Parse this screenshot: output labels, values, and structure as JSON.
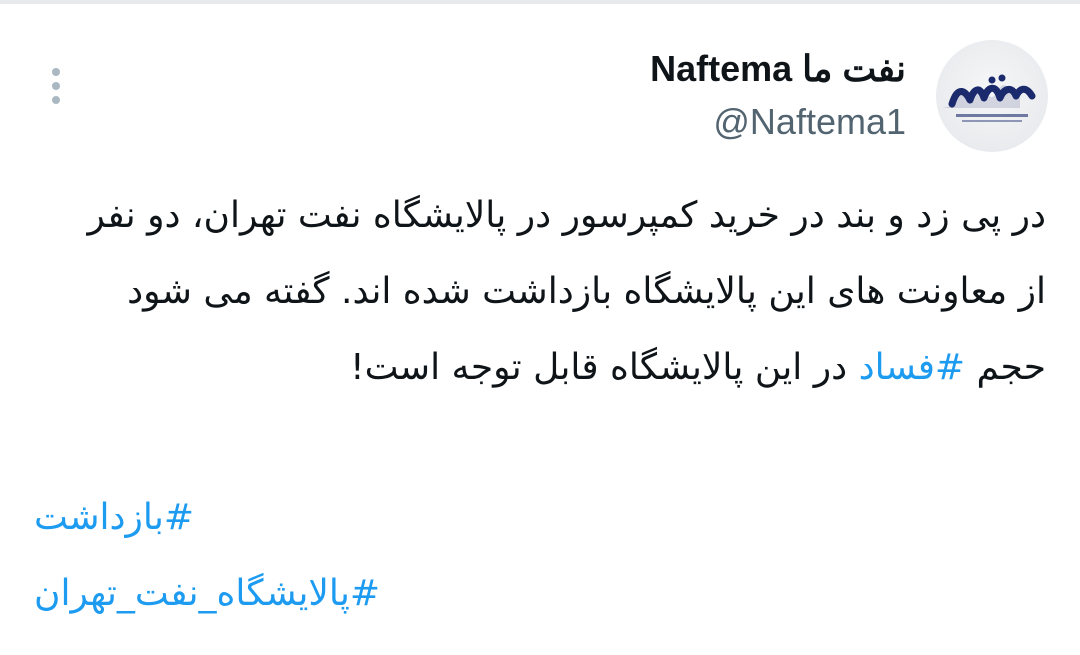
{
  "tweet": {
    "author": {
      "display_name": "نفت ما Naftema",
      "handle": "@Naftema1",
      "avatar_icon": "naftema-logo-icon"
    },
    "more_icon": "more-dots-icon",
    "text": {
      "before_hashtag": "در پی زد و بند در خرید کمپرسور در پالایشگاه نفت تهران، دو نفر از معاونت های این پالایشگاه بازداشت شده اند. گفته می شود حجم ",
      "inline_hashtag": "#فساد",
      "after_hashtag": " در این پالایشگاه قابل توجه است!"
    },
    "hashtags": [
      "#بازداشت",
      "#پالایشگاه_نفت_تهران"
    ]
  },
  "colors": {
    "link": "#1d9bf0",
    "text": "#0f1419",
    "secondary": "#536471",
    "logo": "#1a2a6c"
  }
}
